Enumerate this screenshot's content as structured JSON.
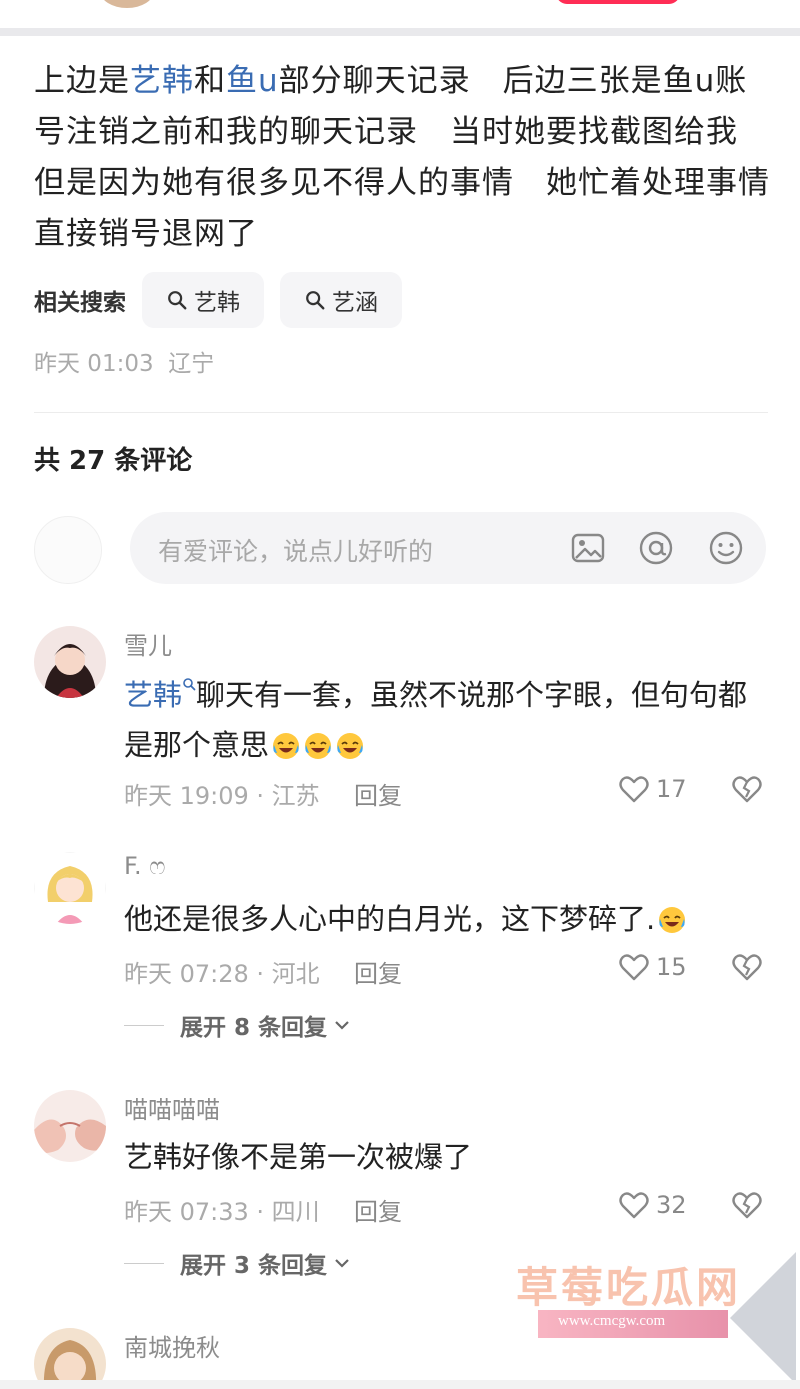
{
  "post": {
    "body_parts": [
      {
        "text": "上边是",
        "tag": false
      },
      {
        "text": "艺韩",
        "tag": true
      },
      {
        "text": "和",
        "tag": false
      },
      {
        "text": "鱼u",
        "tag": true
      },
      {
        "text": "部分聊天记录　后边三张是鱼u账号注销之前和我的聊天记录　当时她要找截图给我　但是因为她有很多见不得人的事情　她忙着处理事情直接销号退网了",
        "tag": false
      }
    ],
    "related_label": "相关搜索",
    "related_chips": [
      "艺韩",
      "艺涵"
    ],
    "time": "昨天 01:03",
    "location": "辽宁"
  },
  "comments_header": {
    "count_text": "共 27 条评论"
  },
  "input": {
    "placeholder": "有爱评论，说点儿好听的",
    "icons": [
      "image-icon",
      "at-icon",
      "emoji-icon"
    ]
  },
  "comments": [
    {
      "name": "雪儿",
      "tag": "艺韩",
      "text": "聊天有一套，虽然不说那个字眼，但句句都是那个意思",
      "emoji_count": 3,
      "meta": "昨天 19:09 · 江苏",
      "reply_label": "回复",
      "likes": "17"
    },
    {
      "name": "F. ෆ",
      "text": "他还是很多人心中的白月光，这下梦碎了.",
      "emoji_count": 1,
      "meta": "昨天 07:28 · 河北",
      "reply_label": "回复",
      "likes": "15",
      "expand": "展开 8 条回复"
    },
    {
      "name": "喵喵喵喵",
      "text": "艺韩好像不是第一次被爆了",
      "meta": "昨天 07:33 · 四川",
      "reply_label": "回复",
      "likes": "32",
      "expand": "展开 3 条回复"
    },
    {
      "name": "南城挽秋"
    }
  ],
  "watermark": {
    "text": "草莓吃瓜网",
    "url": "www.cmcgw.com"
  },
  "colors": {
    "tag_blue": "#3a6cb3",
    "muted": "#aaaaaa",
    "input_bg": "#f4f4f6"
  }
}
